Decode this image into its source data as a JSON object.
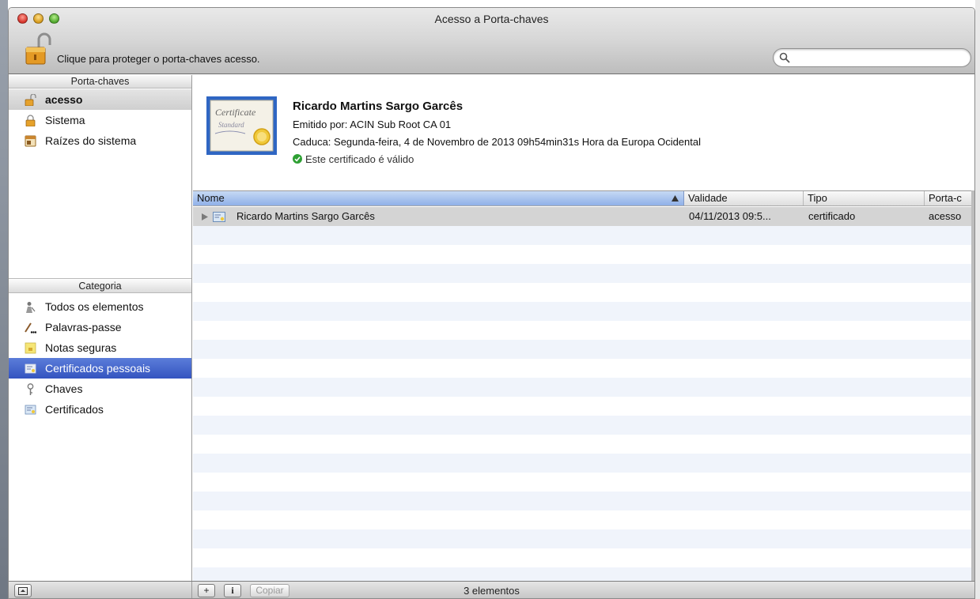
{
  "window": {
    "title": "Acesso a Porta-chaves"
  },
  "toolbar": {
    "lock_message": "Clique para proteger o porta-chaves acesso.",
    "search_placeholder": "",
    "search_value": ""
  },
  "sidebar": {
    "keychains_header": "Porta-chaves",
    "keychains": [
      {
        "label": "acesso",
        "icon": "unlocked-padlock-icon",
        "selected": true
      },
      {
        "label": "Sistema",
        "icon": "padlock-icon",
        "selected": false
      },
      {
        "label": "Raízes do sistema",
        "icon": "cabinet-icon",
        "selected": false
      }
    ],
    "category_header": "Categoria",
    "categories": [
      {
        "label": "Todos os elementos",
        "icon": "people-icon",
        "selected": false
      },
      {
        "label": "Palavras-passe",
        "icon": "pen-dots-icon",
        "selected": false
      },
      {
        "label": "Notas seguras",
        "icon": "note-icon",
        "selected": false
      },
      {
        "label": "Certificados pessoais",
        "icon": "personal-certificate-icon",
        "selected": true
      },
      {
        "label": "Chaves",
        "icon": "key-icon",
        "selected": false
      },
      {
        "label": "Certificados",
        "icon": "certificate-icon",
        "selected": false
      }
    ]
  },
  "detail": {
    "name": "Ricardo Martins Sargo Garcês",
    "issuer": "Emitido por: ACIN Sub Root CA 01",
    "expires": "Caduca: Segunda-feira, 4 de Novembro de 2013 09h54min31s Hora da Europa Ocidental",
    "status": "Este certificado é válido",
    "badge_text_1": "Certificate",
    "badge_text_2": "Standard"
  },
  "table": {
    "columns": [
      "Nome",
      "Validade",
      "Tipo",
      "Porta-c"
    ],
    "rows": [
      {
        "name": "Ricardo Martins Sargo Garcês",
        "validity": "04/11/2013 09:5...",
        "type": "certificado",
        "keychain": "acesso"
      }
    ]
  },
  "bottombar": {
    "add_label": "+",
    "info_label": "i",
    "copy_label": "Copiar",
    "count": "3 elementos"
  },
  "colors": {
    "selection_blue": "#3c5cc6",
    "header_sort_blue": "#a9c3ee",
    "valid_green": "#2ea033"
  }
}
